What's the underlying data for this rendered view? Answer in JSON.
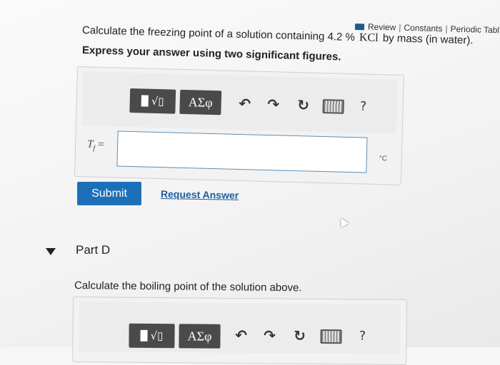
{
  "header_links": {
    "review": "Review",
    "separator": "|",
    "constants": "Constants",
    "periodic": "Periodic Tabl"
  },
  "part_c": {
    "question_prefix": "Calculate the freezing point of a solution containing 4.2",
    "percent": "%",
    "formula": "KCl",
    "question_suffix": "by mass (in water).",
    "instruction": "Express your answer using two significant figures.",
    "variable": "T",
    "variable_sub": "f",
    "equals": "=",
    "input_value": "",
    "unit": "°C",
    "toolbar": {
      "symbols_label": "ΑΣφ",
      "help_label": "?"
    },
    "submit_label": "Submit",
    "request_answer_label": "Request Answer"
  },
  "part_d": {
    "title": "Part D",
    "question": "Calculate the boiling point of the solution above.",
    "toolbar": {
      "symbols_label": "ΑΣφ",
      "help_label": "?"
    }
  },
  "colors": {
    "submit_bg": "#1d70b8",
    "link": "#1d5fa0",
    "toolbar_button": "#4a4a4a",
    "input_border": "#5b8db8"
  },
  "icons": {
    "templates": "templates-icon",
    "undo": "undo-icon",
    "redo": "redo-icon",
    "reset": "reset-icon",
    "keyboard": "keyboard-icon",
    "help": "help-icon"
  }
}
